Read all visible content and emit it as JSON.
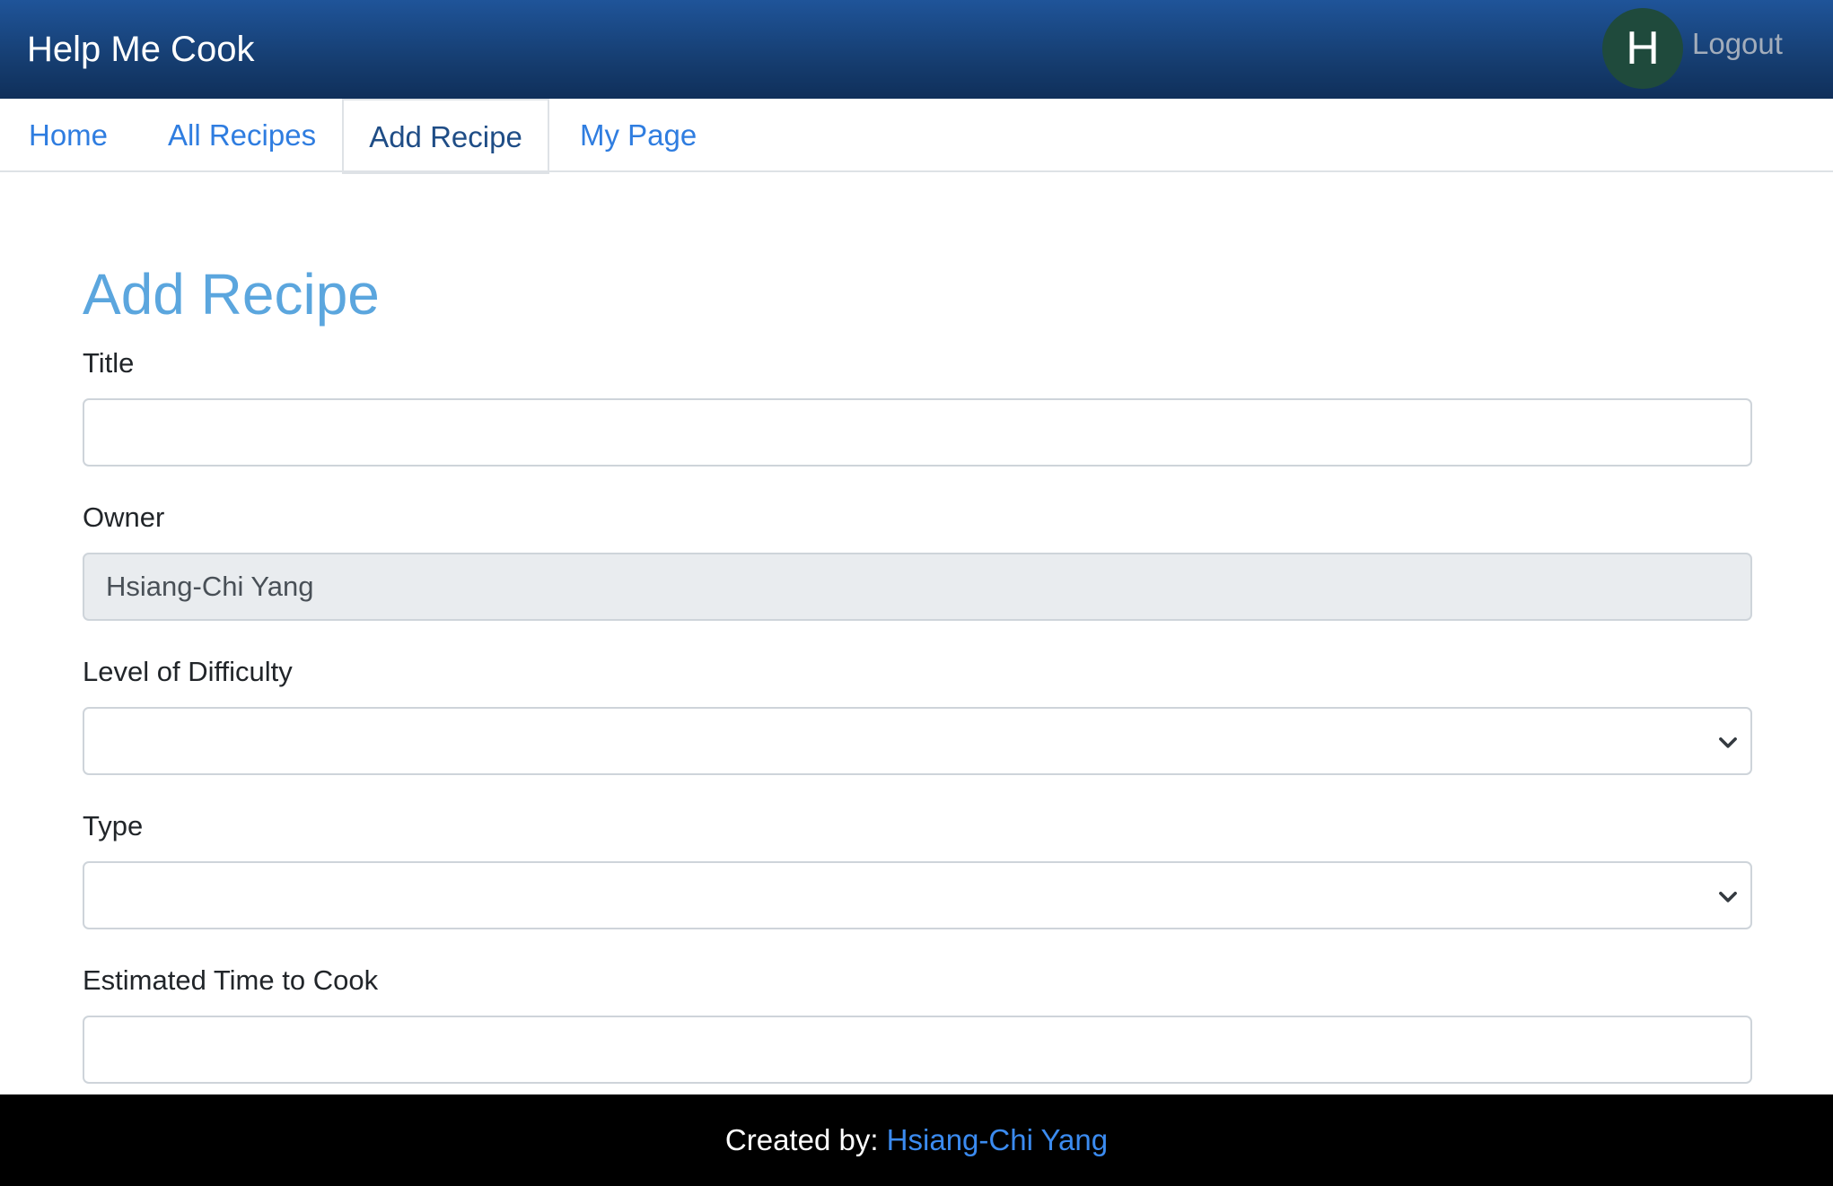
{
  "header": {
    "brand": "Help Me Cook",
    "avatar_initial": "H",
    "logout_label": "Logout"
  },
  "tabs": [
    {
      "label": "Home",
      "active": false
    },
    {
      "label": "All Recipes",
      "active": false
    },
    {
      "label": "Add Recipe",
      "active": true
    },
    {
      "label": "My Page",
      "active": false
    }
  ],
  "form": {
    "heading": "Add Recipe",
    "title": {
      "label": "Title",
      "value": ""
    },
    "owner": {
      "label": "Owner",
      "value": "Hsiang-Chi Yang"
    },
    "difficulty": {
      "label": "Level of Difficulty",
      "value": ""
    },
    "type": {
      "label": "Type",
      "value": ""
    },
    "time": {
      "label": "Estimated Time to Cook",
      "value": ""
    }
  },
  "footer": {
    "prefix": "Created by:",
    "author": "Hsiang-Chi Yang"
  },
  "colors": {
    "header_gradient_top": "#1f5499",
    "header_gradient_bottom": "#0f2f5a",
    "avatar_bg": "#1f4a3c",
    "link": "#2f7de0",
    "heading": "#5ba6de",
    "footer_bg": "#000000"
  },
  "icons": {
    "select_chevron": "chevron-down-icon"
  }
}
